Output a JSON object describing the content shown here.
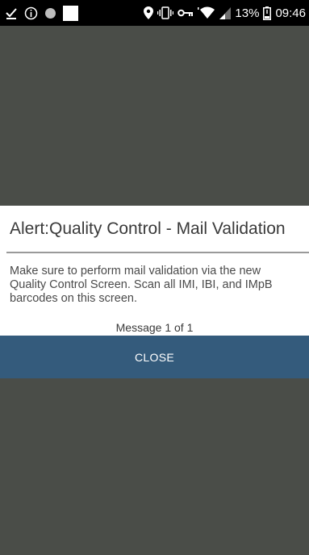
{
  "status_bar": {
    "battery_percent": "13%",
    "time": "09:46",
    "icons_left": [
      "download-done-icon",
      "info-circle-icon",
      "circle-icon",
      "white-square-icon"
    ],
    "icons_right": [
      "location-pin-icon",
      "vibrate-icon",
      "key-icon",
      "wifi-icon",
      "signal-icon",
      "battery-low-icon"
    ]
  },
  "dialog": {
    "title": "Alert:Quality Control - Mail Validation",
    "message": "Make sure to perform mail validation via the new Quality Control Screen. Scan all IMI, IBI, and IMpB barcodes on this screen.",
    "counter": "Message 1 of 1",
    "close_label": "CLOSE"
  },
  "colors": {
    "background": "#4a4d48",
    "status_bar": "#000000",
    "dialog": "#ffffff",
    "button": "#345b7c",
    "button_text": "#ffffff"
  }
}
